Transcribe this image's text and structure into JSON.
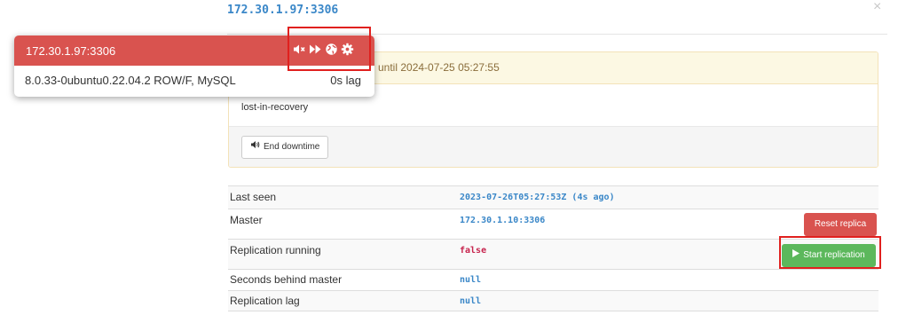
{
  "modal": {
    "title": "172.30.1.97:3306",
    "close_glyph": "×"
  },
  "downtime": {
    "heading": "until 2024-07-25 05:27:55",
    "reason": "lost-in-recovery",
    "end_button": "End downtime"
  },
  "details": {
    "rows": [
      {
        "label": "Last seen",
        "value": "2023-07-26T05:27:53Z (4s ago)"
      },
      {
        "label": "Master",
        "value": "172.30.1.10:3306"
      },
      {
        "label": "Replication running",
        "value": "false"
      },
      {
        "label": "Seconds behind master",
        "value": "null"
      },
      {
        "label": "Replication lag",
        "value": "null"
      }
    ],
    "reset_button": "Reset replica",
    "start_button": "Start replication"
  },
  "popover": {
    "title": "172.30.1.97:3306",
    "version": "8.0.33-0ubuntu0.22.04.2 ROW/F, MySQL",
    "lag": "0s lag",
    "icons": [
      "muted-speaker-icon",
      "fast-forward-icon",
      "globe-icon",
      "gear-icon"
    ]
  },
  "colors": {
    "title_blue": "#3a87c8",
    "danger": "#d9534f",
    "success": "#5cb85c",
    "warning_bg": "#fcf8e3",
    "highlight": "#e0201e"
  }
}
